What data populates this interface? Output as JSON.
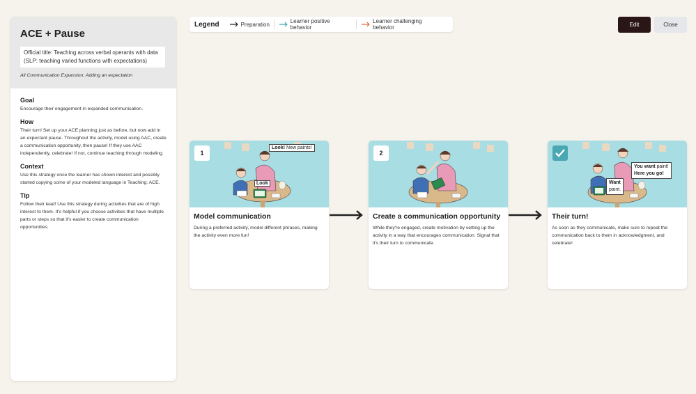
{
  "side": {
    "title": "ACE + Pause",
    "official": "Official title: Teaching across verbal operants with data (SLP: teaching varied functions with expectations)",
    "subtitle": "All Communication Expansion: Adding an expectation",
    "sections": [
      {
        "heading": "Goal",
        "text": "Encourage their engagement in expanded communication."
      },
      {
        "heading": "How",
        "text": "Their turn! Set up your ACE planning just as before, but now add in an expectant pause. Throughout the activity, model using AAC, create a communication opportunity, then pause! If they use AAC independently, celebrate! If not, continue teaching through modeling."
      },
      {
        "heading": "Context",
        "text": "Use this strategy once the learner has shown interest and possibly started copying some of your modeled language in Teaching: ACE."
      },
      {
        "heading": "Tip",
        "text": "Follow their lead! Use this strategy during activities that are of high interest to them. It's helpful if you choose activities that have multiple parts or steps so that it's easier to create communication opportunities."
      }
    ]
  },
  "legend": {
    "title": "Legend",
    "items": [
      {
        "label": "Preparation",
        "color": "#222222"
      },
      {
        "label": "Learner positive behavior",
        "color": "#3aa6b0"
      },
      {
        "label": "Learner challenging behavior",
        "color": "#e2693a"
      }
    ]
  },
  "buttons": {
    "edit": "Edit",
    "close": "Close"
  },
  "cards": [
    {
      "badge": "1",
      "title": "Model communication",
      "desc": "During a preferred activity, model different phrases, making the activity even more fun!",
      "bubble_bold": "Look!",
      "bubble_rest": " New paints!",
      "device_word": "Look"
    },
    {
      "badge": "2",
      "title": "Create a communication opportunity",
      "desc": "While they're engaged, create motivation by setting up the activity in a way that encourages communication. Signal that it's their turn to communicate."
    },
    {
      "badge": "check",
      "title": "Their turn!",
      "desc": "As soon as they communicate, make sure to repeat the communication back to them in acknowledgment, and celebrate!",
      "bubble_bold": "You want",
      "bubble_rest": " paint!",
      "bubble_line2": "Here you go!",
      "child_bold": "Want",
      "child_rest": "paint."
    }
  ]
}
